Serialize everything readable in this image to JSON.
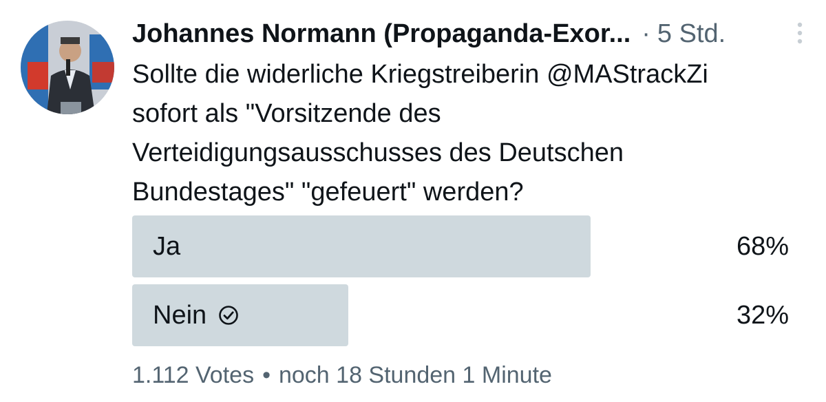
{
  "tweet": {
    "author_name": "Johannes Normann (Propaganda-Exor...",
    "separator": "·",
    "timestamp": "5 Std.",
    "more_icon": "vertical-dots-icon",
    "text_lines": [
      "Sollte die widerliche Kriegstreiberin @MAStrackZi",
      "sofort als \"Vorsitzende des",
      "Verteidigungsausschusses des Deutschen",
      "Bundestages\" \"gefeuert\" werden?"
    ]
  },
  "poll": {
    "options": [
      {
        "label": "Ja",
        "percent_text": "68%",
        "share": 0.68,
        "selected": false
      },
      {
        "label": "Nein",
        "percent_text": "32%",
        "share": 0.32,
        "selected": true,
        "selected_icon": "check-circle-icon"
      }
    ],
    "votes": "1.112 Votes",
    "bullet": "•",
    "remaining": "noch 18 Stunden 1 Minute"
  },
  "colors": {
    "bar": "#cfd9de",
    "text": "#0f1419",
    "secondary_text": "#536471"
  }
}
